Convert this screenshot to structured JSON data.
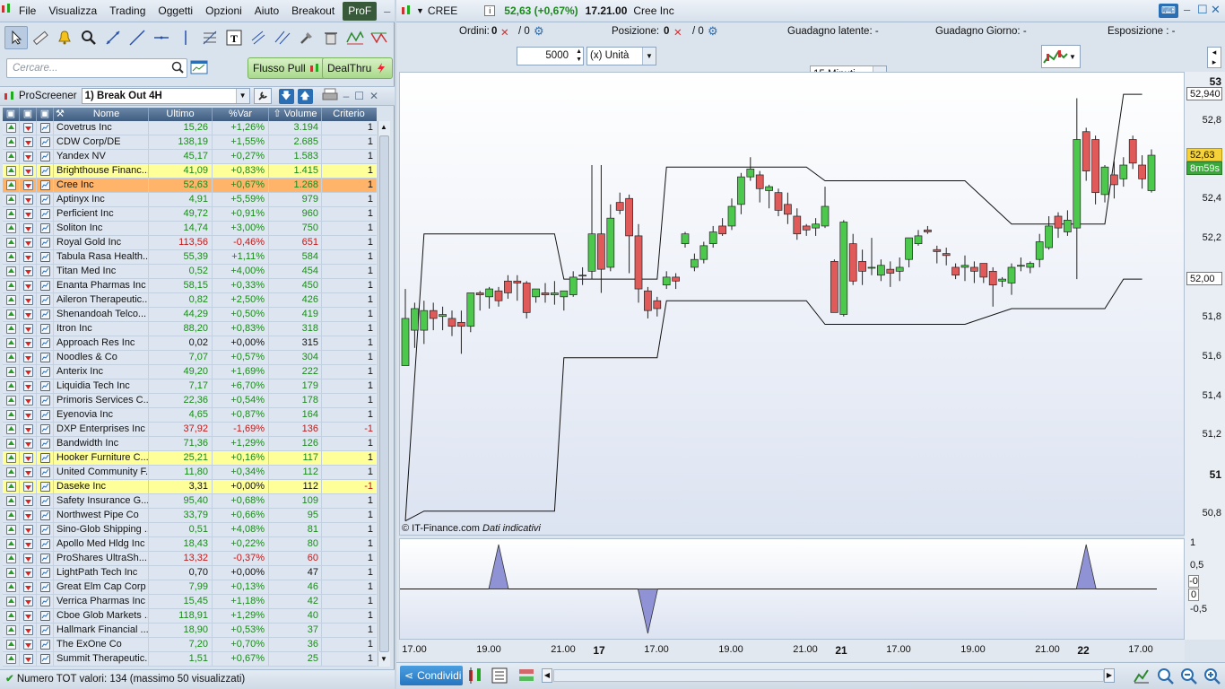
{
  "menu": [
    "File",
    "Visualizza",
    "Trading",
    "Oggetti",
    "Opzioni",
    "Aiuto",
    "Breakout",
    "ProF"
  ],
  "search": {
    "placeholder": "Cercare..."
  },
  "buttons": {
    "flusso": "Flusso Pull",
    "dealthru": "DealThru"
  },
  "screener": {
    "title": "ProScreener",
    "selected": "1) Break Out 4H"
  },
  "table": {
    "headers": {
      "name": "Nome",
      "last": "Ultimo",
      "var": "%Var",
      "volume": "Volume",
      "criterion": "Criterio"
    },
    "rows": [
      {
        "name": "Covetrus Inc",
        "last": "15,26",
        "var": "+1,26%",
        "vol": "3.194",
        "crit": "1",
        "hl": ""
      },
      {
        "name": "CDW Corp/DE",
        "last": "138,19",
        "var": "+1,55%",
        "vol": "2.685",
        "crit": "1",
        "hl": ""
      },
      {
        "name": "Yandex NV",
        "last": "45,17",
        "var": "+0,27%",
        "vol": "1.583",
        "crit": "1",
        "hl": ""
      },
      {
        "name": "Brighthouse Financ...",
        "last": "41,09",
        "var": "+0,83%",
        "vol": "1.415",
        "crit": "1",
        "hl": "hl"
      },
      {
        "name": "Cree Inc",
        "last": "52,63",
        "var": "+0,67%",
        "vol": "1.268",
        "crit": "1",
        "hl": "sel"
      },
      {
        "name": "Aptinyx Inc",
        "last": "4,91",
        "var": "+5,59%",
        "vol": "979",
        "crit": "1",
        "hl": ""
      },
      {
        "name": "Perficient Inc",
        "last": "49,72",
        "var": "+0,91%",
        "vol": "960",
        "crit": "1",
        "hl": ""
      },
      {
        "name": "Soliton Inc",
        "last": "14,74",
        "var": "+3,00%",
        "vol": "750",
        "crit": "1",
        "hl": ""
      },
      {
        "name": "Royal Gold Inc",
        "last": "113,56",
        "var": "-0,46%",
        "vol": "651",
        "crit": "1",
        "hl": ""
      },
      {
        "name": "Tabula Rasa Health...",
        "last": "55,39",
        "var": "+1,11%",
        "vol": "584",
        "crit": "1",
        "hl": ""
      },
      {
        "name": "Titan Med Inc",
        "last": "0,52",
        "var": "+4,00%",
        "vol": "454",
        "crit": "1",
        "hl": ""
      },
      {
        "name": "Enanta Pharmas Inc",
        "last": "58,15",
        "var": "+0,33%",
        "vol": "450",
        "crit": "1",
        "hl": ""
      },
      {
        "name": "Aileron Therapeutic...",
        "last": "0,82",
        "var": "+2,50%",
        "vol": "426",
        "crit": "1",
        "hl": ""
      },
      {
        "name": "Shenandoah Telco...",
        "last": "44,29",
        "var": "+0,50%",
        "vol": "419",
        "crit": "1",
        "hl": ""
      },
      {
        "name": "Itron Inc",
        "last": "88,20",
        "var": "+0,83%",
        "vol": "318",
        "crit": "1",
        "hl": ""
      },
      {
        "name": "Approach Res Inc",
        "last": "0,02",
        "var": "+0,00%",
        "vol": "315",
        "crit": "1",
        "hl": ""
      },
      {
        "name": "Noodles & Co",
        "last": "7,07",
        "var": "+0,57%",
        "vol": "304",
        "crit": "1",
        "hl": ""
      },
      {
        "name": "Anterix Inc",
        "last": "49,20",
        "var": "+1,69%",
        "vol": "222",
        "crit": "1",
        "hl": ""
      },
      {
        "name": "Liquidia Tech Inc",
        "last": "7,17",
        "var": "+6,70%",
        "vol": "179",
        "crit": "1",
        "hl": ""
      },
      {
        "name": "Primoris Services C...",
        "last": "22,36",
        "var": "+0,54%",
        "vol": "178",
        "crit": "1",
        "hl": ""
      },
      {
        "name": "Eyenovia Inc",
        "last": "4,65",
        "var": "+0,87%",
        "vol": "164",
        "crit": "1",
        "hl": ""
      },
      {
        "name": "DXP Enterprises Inc",
        "last": "37,92",
        "var": "-1,69%",
        "vol": "136",
        "crit": "-1",
        "hl": ""
      },
      {
        "name": "Bandwidth Inc",
        "last": "71,36",
        "var": "+1,29%",
        "vol": "126",
        "crit": "1",
        "hl": ""
      },
      {
        "name": "Hooker Furniture C...",
        "last": "25,21",
        "var": "+0,16%",
        "vol": "117",
        "crit": "1",
        "hl": "hl"
      },
      {
        "name": "United Community F...",
        "last": "11,80",
        "var": "+0,34%",
        "vol": "112",
        "crit": "1",
        "hl": ""
      },
      {
        "name": "Daseke Inc",
        "last": "3,31",
        "var": "+0,00%",
        "vol": "112",
        "crit": "-1",
        "hl": "hl"
      },
      {
        "name": "Safety Insurance G...",
        "last": "95,40",
        "var": "+0,68%",
        "vol": "109",
        "crit": "1",
        "hl": ""
      },
      {
        "name": "Northwest Pipe Co",
        "last": "33,79",
        "var": "+0,66%",
        "vol": "95",
        "crit": "1",
        "hl": ""
      },
      {
        "name": "Sino-Glob Shipping ...",
        "last": "0,51",
        "var": "+4,08%",
        "vol": "81",
        "crit": "1",
        "hl": ""
      },
      {
        "name": "Apollo Med Hldg Inc",
        "last": "18,43",
        "var": "+0,22%",
        "vol": "80",
        "crit": "1",
        "hl": ""
      },
      {
        "name": "ProShares UltraSh...",
        "last": "13,32",
        "var": "-0,37%",
        "vol": "60",
        "crit": "1",
        "hl": ""
      },
      {
        "name": "LightPath Tech Inc",
        "last": "0,70",
        "var": "+0,00%",
        "vol": "47",
        "crit": "1",
        "hl": ""
      },
      {
        "name": "Great Elm Cap Corp",
        "last": "7,99",
        "var": "+0,13%",
        "vol": "46",
        "crit": "1",
        "hl": ""
      },
      {
        "name": "Verrica Pharmas Inc",
        "last": "15,45",
        "var": "+1,18%",
        "vol": "42",
        "crit": "1",
        "hl": ""
      },
      {
        "name": "Cboe Glob Markets ...",
        "last": "118,91",
        "var": "+1,29%",
        "vol": "40",
        "crit": "1",
        "hl": ""
      },
      {
        "name": "Hallmark Financial ...",
        "last": "18,90",
        "var": "+0,53%",
        "vol": "37",
        "crit": "1",
        "hl": ""
      },
      {
        "name": "The ExOne Co",
        "last": "7,20",
        "var": "+0,70%",
        "vol": "36",
        "crit": "1",
        "hl": ""
      },
      {
        "name": "Summit Therapeutic...",
        "last": "1,51",
        "var": "+0,67%",
        "vol": "25",
        "crit": "1",
        "hl": ""
      }
    ]
  },
  "status": "Numero TOT valori: 134 (massimo 50 visualizzati)",
  "chart_header": {
    "ticker": "CREE",
    "change": "52,63 (+0,67%)",
    "time": "17.21.00",
    "name": "Cree Inc"
  },
  "info": {
    "orders_label": "Ordini:",
    "orders_val": "0",
    "orders_slash": "/ 0",
    "pos_label": "Posizione:",
    "pos_val": "0",
    "pos_slash": "/ 0",
    "latent": "Guadagno latente: -",
    "daily": "Guadagno Giorno: -",
    "exposure": "Esposizione : -"
  },
  "controls": {
    "qty": "5000",
    "unit": "(x) Unità",
    "timeframe": "15 Minuti"
  },
  "source": {
    "name": "© IT-Finance.com",
    "note": "Dati indicativi"
  },
  "price_tags": {
    "top": "52,940",
    "current": "52,63",
    "timer": "8m59s",
    "low": "52,00"
  },
  "bottom": {
    "share": "Condividi"
  },
  "chart_data": {
    "type": "candlestick",
    "y_ticks": [
      "53",
      "52,8",
      "52,6",
      "52,4",
      "52,2",
      "52",
      "51,8",
      "51,6",
      "51,4",
      "51,2",
      "51",
      "50,8"
    ],
    "ylim": [
      50.7,
      53.05
    ],
    "x_ticks": [
      "17.00",
      "19.00",
      "21.00",
      "17",
      "17.00",
      "19.00",
      "21.00",
      "21",
      "17.00",
      "19.00",
      "21.00",
      "22",
      "17.00"
    ],
    "x_ticks_bold": [
      false,
      false,
      false,
      true,
      false,
      false,
      false,
      true,
      false,
      false,
      false,
      true,
      false
    ],
    "candles": [
      [
        51.56,
        51.8,
        51.64,
        51.95
      ],
      [
        51.74,
        51.85,
        51.65,
        51.88
      ],
      [
        51.74,
        51.84,
        51.67,
        51.89
      ],
      [
        51.84,
        51.8,
        51.74,
        51.88
      ],
      [
        51.81,
        51.82,
        51.74,
        51.86
      ],
      [
        51.8,
        51.76,
        51.71,
        51.84
      ],
      [
        51.78,
        51.76,
        51.62,
        51.84
      ],
      [
        51.76,
        51.93,
        51.73,
        51.93
      ],
      [
        51.93,
        51.92,
        51.84,
        51.94
      ],
      [
        51.91,
        51.95,
        51.85,
        51.96
      ],
      [
        51.94,
        51.89,
        51.86,
        51.96
      ],
      [
        51.99,
        51.93,
        51.9,
        52.02
      ],
      [
        51.99,
        51.98,
        51.89,
        52.02
      ],
      [
        51.98,
        51.83,
        51.8,
        51.99
      ],
      [
        51.91,
        51.95,
        51.88,
        51.95
      ],
      [
        51.93,
        51.92,
        51.88,
        51.98
      ],
      [
        51.92,
        51.93,
        51.87,
        51.99
      ],
      [
        51.91,
        51.94,
        51.84,
        51.94
      ],
      [
        51.92,
        52.01,
        51.91,
        52.04
      ],
      [
        52.02,
        52.02,
        51.97,
        52.06
      ],
      [
        52.04,
        52.23,
        52.0,
        52.58
      ],
      [
        52.23,
        52.05,
        51.93,
        52.58
      ],
      [
        52.06,
        52.31,
        52.04,
        52.38
      ],
      [
        52.39,
        52.35,
        52.33,
        52.44
      ],
      [
        52.41,
        52.22,
        52.03,
        52.43
      ],
      [
        52.22,
        51.95,
        51.88,
        52.28
      ],
      [
        51.94,
        51.84,
        51.8,
        51.96
      ],
      [
        51.89,
        51.85,
        51.81,
        51.91
      ],
      [
        51.97,
        52.01,
        51.95,
        52.04
      ],
      [
        52.01,
        51.99,
        51.95,
        52.03
      ],
      [
        52.18,
        52.23,
        52.16,
        52.24
      ],
      [
        52.06,
        52.1,
        52.04,
        52.13
      ],
      [
        52.1,
        52.17,
        52.08,
        52.19
      ],
      [
        52.18,
        52.24,
        52.16,
        52.27
      ],
      [
        52.27,
        52.23,
        52.22,
        52.31
      ],
      [
        52.27,
        52.37,
        52.25,
        52.41
      ],
      [
        52.38,
        52.52,
        52.33,
        52.54
      ],
      [
        52.52,
        52.56,
        52.5,
        52.62
      ],
      [
        52.53,
        52.46,
        52.39,
        52.55
      ],
      [
        52.45,
        52.47,
        52.36,
        52.48
      ],
      [
        52.44,
        52.35,
        52.32,
        52.46
      ],
      [
        52.38,
        52.33,
        52.28,
        52.44
      ],
      [
        52.32,
        52.23,
        52.2,
        52.36
      ],
      [
        52.27,
        52.25,
        52.22,
        52.28
      ],
      [
        52.26,
        52.28,
        52.22,
        52.31
      ],
      [
        52.27,
        52.37,
        52.26,
        52.47
      ],
      [
        52.09,
        51.83,
        51.83,
        52.1
      ],
      [
        51.82,
        52.29,
        51.81,
        52.3
      ],
      [
        52.18,
        51.99,
        51.97,
        52.23
      ],
      [
        52.09,
        52.04,
        51.97,
        52.15
      ],
      [
        52.06,
        52.06,
        52.02,
        52.21
      ],
      [
        52.02,
        52.07,
        51.99,
        52.1
      ],
      [
        52.05,
        52.03,
        51.96,
        52.09
      ],
      [
        52.04,
        52.06,
        51.99,
        52.11
      ],
      [
        52.1,
        52.21,
        52.06,
        52.21
      ],
      [
        52.18,
        52.22,
        52.17,
        52.25
      ],
      [
        52.25,
        52.24,
        52.23,
        52.27
      ],
      [
        52.15,
        52.14,
        52.08,
        52.17
      ],
      [
        52.13,
        52.12,
        52.07,
        52.16
      ],
      [
        52.06,
        52.02,
        52.0,
        52.08
      ],
      [
        52.06,
        52.07,
        51.99,
        52.12
      ],
      [
        52.06,
        52.04,
        51.98,
        52.09
      ],
      [
        52.08,
        52.01,
        51.98,
        52.08
      ],
      [
        52.04,
        51.97,
        51.86,
        52.06
      ],
      [
        51.99,
        52.0,
        51.96,
        52.01
      ],
      [
        51.98,
        52.06,
        51.92,
        52.08
      ],
      [
        52.07,
        52.07,
        52.04,
        52.11
      ],
      [
        52.06,
        52.08,
        52.03,
        52.09
      ],
      [
        52.1,
        52.19,
        52.06,
        52.23
      ],
      [
        52.16,
        52.27,
        52.15,
        52.32
      ],
      [
        52.32,
        52.26,
        52.21,
        52.34
      ],
      [
        52.24,
        52.3,
        52.22,
        52.35
      ],
      [
        52.26,
        52.71,
        52.0,
        52.92
      ],
      [
        52.75,
        52.55,
        52.5,
        52.77
      ],
      [
        52.71,
        52.44,
        52.38,
        52.73
      ],
      [
        52.43,
        52.57,
        52.39,
        52.58
      ],
      [
        52.53,
        52.48,
        52.41,
        52.6
      ],
      [
        52.51,
        52.58,
        52.47,
        52.62
      ],
      [
        52.71,
        52.59,
        52.56,
        52.73
      ],
      [
        52.58,
        52.51,
        52.46,
        52.63
      ],
      [
        52.45,
        52.63,
        52.44,
        52.66
      ]
    ],
    "upper_band": [
      [
        0,
        50.77
      ],
      [
        2,
        52.23
      ],
      [
        16,
        52.23
      ],
      [
        17,
        52.0
      ],
      [
        27,
        52.0
      ],
      [
        28,
        52.57
      ],
      [
        43,
        52.57
      ],
      [
        45,
        52.5
      ],
      [
        60,
        52.5
      ],
      [
        65,
        52.28
      ],
      [
        75,
        52.28
      ],
      [
        77,
        52.94
      ],
      [
        79,
        52.94
      ]
    ],
    "lower_band": [
      [
        0,
        50.77
      ],
      [
        2,
        50.82
      ],
      [
        16,
        50.82
      ],
      [
        17,
        51.6
      ],
      [
        27,
        51.6
      ],
      [
        28,
        51.89
      ],
      [
        43,
        51.89
      ],
      [
        45,
        51.77
      ],
      [
        60,
        51.77
      ],
      [
        65,
        51.85
      ],
      [
        75,
        51.85
      ],
      [
        77,
        52.0
      ],
      [
        79,
        52.0
      ]
    ],
    "oscillator": {
      "yticks": [
        "1",
        "0,5",
        "-0",
        "0",
        "-0,5"
      ],
      "ylim": [
        -1,
        1
      ],
      "spikes": [
        [
          10,
          1
        ],
        [
          26,
          -1
        ],
        [
          73,
          1
        ]
      ]
    }
  }
}
